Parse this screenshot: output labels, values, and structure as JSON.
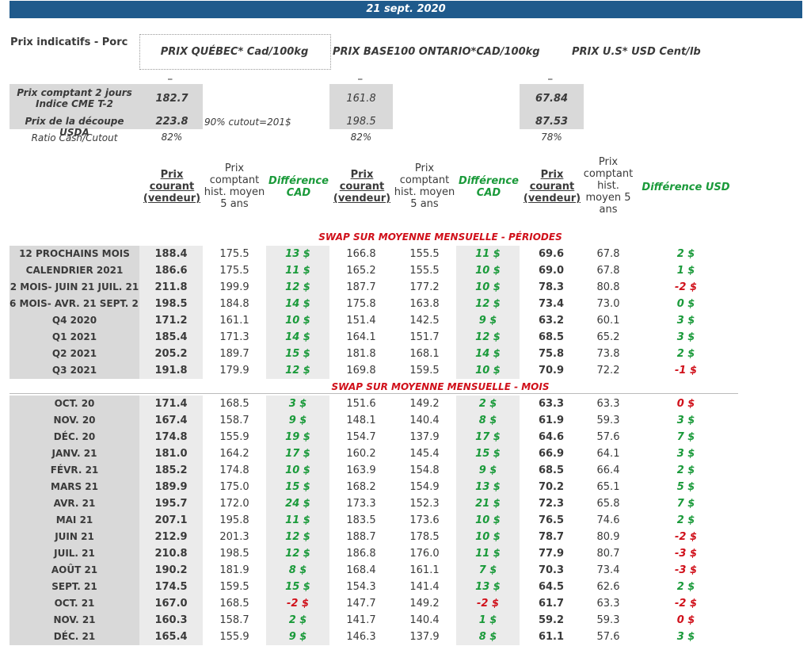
{
  "date": "21 sept. 2020",
  "section_title": "Prix indicatifs - Porc",
  "markets": {
    "quebec": "PRIX QUÉBEC* Cad/100kg",
    "ontario": "PRIX BASE100 ONTARIO*CAD/100kg",
    "us": "PRIX U.S* USD Cent/lb"
  },
  "dash": "_",
  "indicators": {
    "cash_label": "Prix comptant 2 jours Indice CME T-2",
    "cutout_label": "Prix de la découpe USDA",
    "ratio_label": "Ratio Cash/Cutout",
    "cutout_note": "90% cutout=201$",
    "quebec": {
      "cash": "182.7",
      "cutout": "223.8",
      "ratio": "82%"
    },
    "ontario": {
      "cash": "161.8",
      "cutout": "198.5",
      "ratio": "82%"
    },
    "us": {
      "cash": "67.84",
      "cutout": "87.53",
      "ratio": "78%"
    }
  },
  "col_headers": {
    "current": "Prix courant (vendeur)",
    "hist": "Prix comptant hist. moyen 5 ans",
    "hist_us": "Prix comptant hist. moyen 5 ans",
    "diff_cad": "Différence CAD",
    "diff_usd": "Différence USD"
  },
  "periods_title": "SWAP SUR MOYENNE MENSUELLE - PÉRIODES",
  "months_title": "SWAP SUR MOYENNE MENSUELLE - MOIS",
  "periods": [
    {
      "label": "12 PROCHAINS MOIS",
      "q": "188.4",
      "qh": "175.5",
      "qd": "13 $",
      "o": "166.8",
      "oh": "155.5",
      "od": "11 $",
      "u": "69.6",
      "uh": "67.8",
      "ud": "2 $"
    },
    {
      "label": "CALENDRIER 2021",
      "q": "186.6",
      "qh": "175.5",
      "qd": "11 $",
      "o": "165.2",
      "oh": "155.5",
      "od": "10 $",
      "u": "69.0",
      "uh": "67.8",
      "ud": "1 $"
    },
    {
      "label": "2 MOIS- JUIN 21 JUIL. 21",
      "q": "211.8",
      "qh": "199.9",
      "qd": "12 $",
      "o": "187.7",
      "oh": "177.2",
      "od": "10 $",
      "u": "78.3",
      "uh": "80.8",
      "ud": "-2 $"
    },
    {
      "label": "6 MOIS- AVR. 21 SEPT. 21",
      "q": "198.5",
      "qh": "184.8",
      "qd": "14 $",
      "o": "175.8",
      "oh": "163.8",
      "od": "12 $",
      "u": "73.4",
      "uh": "73.0",
      "ud": "0 $"
    },
    {
      "label": "Q4 2020",
      "q": "171.2",
      "qh": "161.1",
      "qd": "10 $",
      "o": "151.4",
      "oh": "142.5",
      "od": "9 $",
      "u": "63.2",
      "uh": "60.1",
      "ud": "3 $"
    },
    {
      "label": "Q1 2021",
      "q": "185.4",
      "qh": "171.3",
      "qd": "14 $",
      "o": "164.1",
      "oh": "151.7",
      "od": "12 $",
      "u": "68.5",
      "uh": "65.2",
      "ud": "3 $"
    },
    {
      "label": "Q2 2021",
      "q": "205.2",
      "qh": "189.7",
      "qd": "15 $",
      "o": "181.8",
      "oh": "168.1",
      "od": "14 $",
      "u": "75.8",
      "uh": "73.8",
      "ud": "2 $"
    },
    {
      "label": "Q3 2021",
      "q": "191.8",
      "qh": "179.9",
      "qd": "12 $",
      "o": "169.8",
      "oh": "159.5",
      "od": "10 $",
      "u": "70.9",
      "uh": "72.2",
      "ud": "-1 $"
    }
  ],
  "months": [
    {
      "label": "OCT. 20",
      "q": "171.4",
      "qh": "168.5",
      "qd": "3 $",
      "o": "151.6",
      "oh": "149.2",
      "od": "2 $",
      "u": "63.3",
      "uh": "63.3",
      "ud": "0 $"
    },
    {
      "label": "NOV. 20",
      "q": "167.4",
      "qh": "158.7",
      "qd": "9 $",
      "o": "148.1",
      "oh": "140.4",
      "od": "8 $",
      "u": "61.9",
      "uh": "59.3",
      "ud": "3 $"
    },
    {
      "label": "DÉC. 20",
      "q": "174.8",
      "qh": "155.9",
      "qd": "19 $",
      "o": "154.7",
      "oh": "137.9",
      "od": "17 $",
      "u": "64.6",
      "uh": "57.6",
      "ud": "7 $"
    },
    {
      "label": "JANV. 21",
      "q": "181.0",
      "qh": "164.2",
      "qd": "17 $",
      "o": "160.2",
      "oh": "145.4",
      "od": "15 $",
      "u": "66.9",
      "uh": "64.1",
      "ud": "3 $"
    },
    {
      "label": "FÉVR. 21",
      "q": "185.2",
      "qh": "174.8",
      "qd": "10 $",
      "o": "163.9",
      "oh": "154.8",
      "od": "9 $",
      "u": "68.5",
      "uh": "66.4",
      "ud": "2 $"
    },
    {
      "label": "MARS 21",
      "q": "189.9",
      "qh": "175.0",
      "qd": "15 $",
      "o": "168.2",
      "oh": "154.9",
      "od": "13 $",
      "u": "70.2",
      "uh": "65.1",
      "ud": "5 $"
    },
    {
      "label": "AVR. 21",
      "q": "195.7",
      "qh": "172.0",
      "qd": "24 $",
      "o": "173.3",
      "oh": "152.3",
      "od": "21 $",
      "u": "72.3",
      "uh": "65.8",
      "ud": "7 $"
    },
    {
      "label": "MAI 21",
      "q": "207.1",
      "qh": "195.8",
      "qd": "11 $",
      "o": "183.5",
      "oh": "173.6",
      "od": "10 $",
      "u": "76.5",
      "uh": "74.6",
      "ud": "2 $"
    },
    {
      "label": "JUIN 21",
      "q": "212.9",
      "qh": "201.3",
      "qd": "12 $",
      "o": "188.7",
      "oh": "178.5",
      "od": "10 $",
      "u": "78.7",
      "uh": "80.9",
      "ud": "-2 $"
    },
    {
      "label": "JUIL. 21",
      "q": "210.8",
      "qh": "198.5",
      "qd": "12 $",
      "o": "186.8",
      "oh": "176.0",
      "od": "11 $",
      "u": "77.9",
      "uh": "80.7",
      "ud": "-3 $"
    },
    {
      "label": "AOÛT 21",
      "q": "190.2",
      "qh": "181.9",
      "qd": "8 $",
      "o": "168.4",
      "oh": "161.1",
      "od": "7 $",
      "u": "70.3",
      "uh": "73.4",
      "ud": "-3 $"
    },
    {
      "label": "SEPT. 21",
      "q": "174.5",
      "qh": "159.5",
      "qd": "15 $",
      "o": "154.3",
      "oh": "141.4",
      "od": "13 $",
      "u": "64.5",
      "uh": "62.6",
      "ud": "2 $"
    },
    {
      "label": "OCT. 21",
      "q": "167.0",
      "qh": "168.5",
      "qd": "-2 $",
      "o": "147.7",
      "oh": "149.2",
      "od": "-2 $",
      "u": "61.7",
      "uh": "63.3",
      "ud": "-2 $"
    },
    {
      "label": "NOV. 21",
      "q": "160.3",
      "qh": "158.7",
      "qd": "2 $",
      "o": "141.7",
      "oh": "140.4",
      "od": "1 $",
      "u": "59.2",
      "uh": "59.3",
      "ud": "0 $"
    },
    {
      "label": "DÉC. 21",
      "q": "165.4",
      "qh": "155.9",
      "qd": "9 $",
      "o": "146.3",
      "oh": "137.9",
      "od": "8 $",
      "u": "61.1",
      "uh": "57.6",
      "ud": "3 $"
    }
  ],
  "colors": {
    "header_bar": "#1f5a8c",
    "positive": "#1a9a3a",
    "negative": "#d0101a",
    "label_bg": "#d9d9d9"
  }
}
